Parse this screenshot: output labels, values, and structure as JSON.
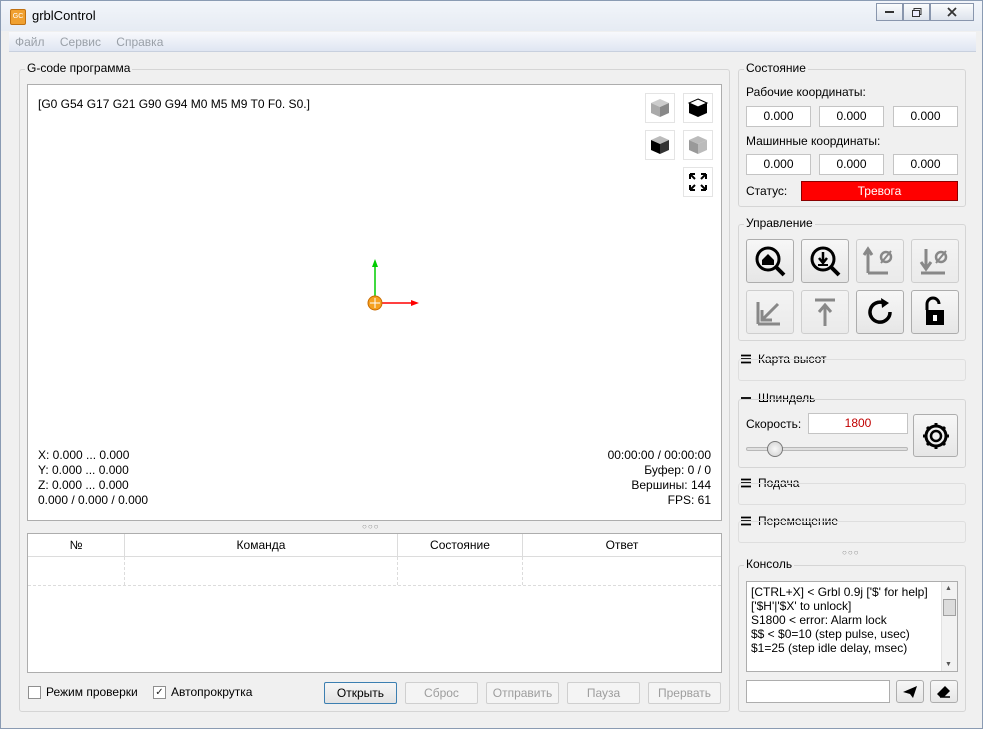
{
  "window": {
    "title": "grblControl"
  },
  "menu": [
    "Файл",
    "Сервис",
    "Справка"
  ],
  "program_group": {
    "title": "G-code программа",
    "gcode_state": "[G0 G54 G17 G21 G90 G94 M0 M5 M9 T0 F0. S0.]",
    "bounds": [
      "X: 0.000 ... 0.000",
      "Y: 0.000 ... 0.000",
      "Z: 0.000 ... 0.000",
      "0.000 / 0.000 / 0.000"
    ],
    "stats": [
      "00:00:00 / 00:00:00",
      "Буфер: 0 / 0",
      "Вершины: 144",
      "FPS: 61"
    ]
  },
  "table": {
    "columns": [
      "№",
      "Команда",
      "Состояние",
      "Ответ"
    ]
  },
  "bottom": {
    "check_mode": "Режим проверки",
    "autoscroll": "Автопрокрутка",
    "buttons": [
      "Открыть",
      "Сброс",
      "Отправить",
      "Пауза",
      "Прервать"
    ]
  },
  "state_group": {
    "title": "Состояние",
    "work_label": "Рабочие координаты:",
    "work": [
      "0.000",
      "0.000",
      "0.000"
    ],
    "machine_label": "Машинные координаты:",
    "machine": [
      "0.000",
      "0.000",
      "0.000"
    ],
    "status_label": "Статус:",
    "status_value": "Тревога",
    "status_color": "#ff0000"
  },
  "control_group": {
    "title": "Управление"
  },
  "heightmap": {
    "title": "Карта высот"
  },
  "spindle": {
    "title": "Шпиндель",
    "speed_label": "Скорость:",
    "speed_value": "1800",
    "slider_level": 0.18
  },
  "feed": {
    "title": "Подача"
  },
  "jog": {
    "title": "Перемещение"
  },
  "console": {
    "title": "Консоль",
    "text": "[CTRL+X] < Grbl 0.9j ['$' for help]\n['$H'|'$X' to unlock]\nS1800 < error: Alarm lock\n$$ < $0=10 (step pulse, usec)\n$1=25 (step idle delay, msec)"
  }
}
